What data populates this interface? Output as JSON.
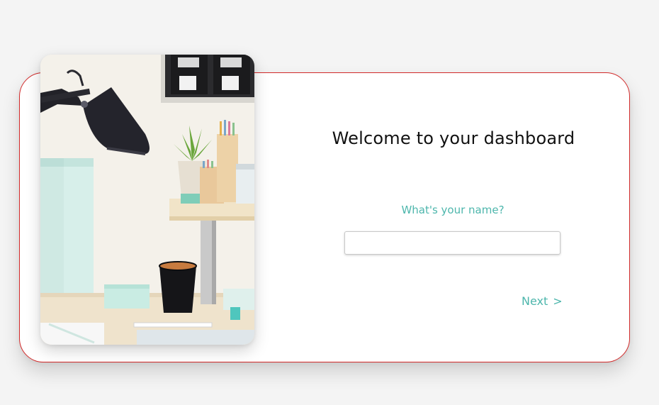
{
  "welcome": {
    "title": "Welcome to your dashboard",
    "question": "What's your name?",
    "name_value": "",
    "name_placeholder": "",
    "next_label": "Next",
    "next_arrow": ">"
  },
  "colors": {
    "accent": "#4db6ac",
    "card_border": "#d22a2a",
    "background": "#f4f4f4"
  }
}
